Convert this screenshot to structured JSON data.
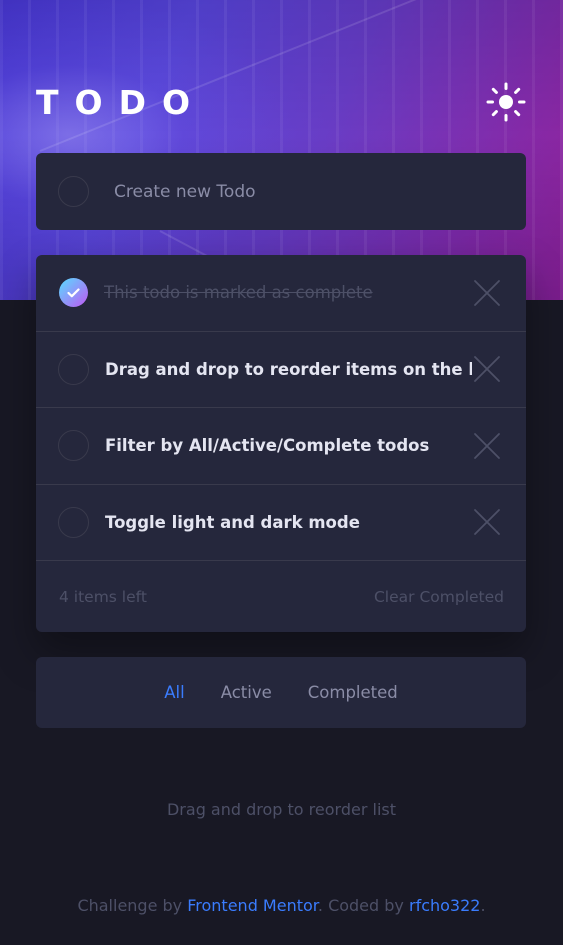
{
  "header": {
    "title": "TODO",
    "theme_icon": "sun-icon"
  },
  "create": {
    "placeholder": "Create new Todo",
    "value": ""
  },
  "todos": [
    {
      "text": "This todo is marked as complete",
      "completed": true
    },
    {
      "text": "Drag and drop to reorder items on the list",
      "completed": false
    },
    {
      "text": "Filter by All/Active/Complete todos",
      "completed": false
    },
    {
      "text": "Toggle light and dark mode",
      "completed": false
    }
  ],
  "list_footer": {
    "items_left": "4 items left",
    "clear_label": "Clear Completed"
  },
  "filters": [
    {
      "label": "All",
      "active": true
    },
    {
      "label": "Active",
      "active": false
    },
    {
      "label": "Completed",
      "active": false
    }
  ],
  "hint": "Drag and drop to reorder list",
  "attribution": {
    "prefix": "Challenge by ",
    "mentor_link": "Frontend Mentor",
    "middle": ". Coded by ",
    "author_link": "rfcho322",
    "suffix": "."
  },
  "colors": {
    "background": "#181824",
    "card": "#25273c",
    "divider": "#393a4c",
    "text": "#e4e5f1",
    "muted": "#4d5067",
    "accent": "#3a7cfd",
    "check_gradient_start": "#57ddff",
    "check_gradient_end": "#c058f3"
  }
}
